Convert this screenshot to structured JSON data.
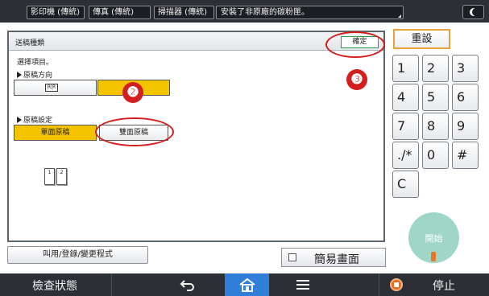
{
  "topbar": {
    "tabs": [
      "影印機 (傳統)",
      "傳真 (傳統)",
      "掃描器 (傳統)"
    ],
    "message": "安裝了非原廠的碳粉匣。"
  },
  "panel": {
    "title": "送稿種類",
    "ok_label": "確定",
    "instruction": "選擇項目。",
    "section_orientation": "原稿方向",
    "orientation_icon_text": "R​R",
    "section_setting": "原稿設定",
    "single_sided_label": "單面原稿",
    "double_sided_label": "雙面原稿",
    "page_numbers": [
      "1",
      "2"
    ]
  },
  "annotations": {
    "badge_2": "❷",
    "badge_3": "❸",
    "color": "#d21f1f"
  },
  "keypad": {
    "reset_label": "重設",
    "keys": [
      "1",
      "2",
      "3",
      "4",
      "5",
      "6",
      "7",
      "8",
      "9",
      "./*",
      "0",
      "#",
      "C"
    ]
  },
  "start": {
    "label": "開始",
    "color": "#9fd6c7"
  },
  "footer": {
    "program_button": "叫用/登錄/變更程式",
    "simple_screen": "簡易畫面"
  },
  "bottombar": {
    "status_label": "檢查狀態",
    "stop_label": "停止",
    "back_icon": "back-arrow-icon",
    "home_icon": "home-icon",
    "menu_icon": "menu-icon",
    "accent": "#2f7ed8"
  }
}
